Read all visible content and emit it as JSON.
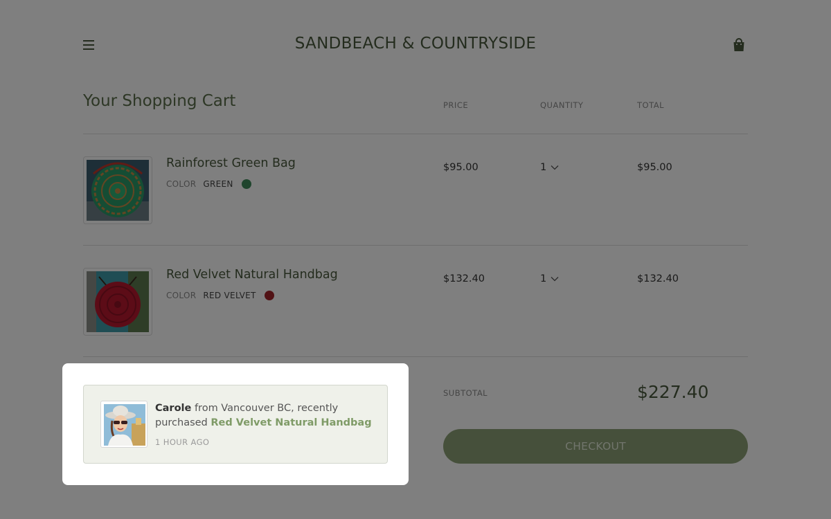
{
  "header": {
    "brand": "SANDBEACH & COUNTRYSIDE",
    "menu_icon": "hamburger-menu-icon",
    "cart_icon": "shopping-bag-icon"
  },
  "cart": {
    "title": "Your Shopping Cart",
    "columns": {
      "price": "PRICE",
      "quantity": "QUANTITY",
      "total": "TOTAL"
    },
    "items": [
      {
        "name": "Rainforest Green Bag",
        "color_label": "COLOR",
        "color_name": "GREEN",
        "swatch": "#3f8a5a",
        "price": "$95.00",
        "quantity": "1",
        "total": "$95.00"
      },
      {
        "name": "Red Velvet Natural Handbag",
        "color_label": "COLOR",
        "color_name": "RED VELVET",
        "swatch": "#a3252a",
        "price": "$132.40",
        "quantity": "1",
        "total": "$132.40"
      }
    ],
    "subtotal_label": "SUBTOTAL",
    "subtotal_value": "$227.40",
    "checkout_label": "CHECKOUT"
  },
  "notification": {
    "customer": "Carole",
    "location_text": "from Vancouver BC, recently purchased",
    "product": "Red Velvet Natural Handbag",
    "time": "1 HOUR AGO"
  },
  "colors": {
    "brand_green": "#48593c",
    "button_green": "#8da177",
    "overlay": "rgba(0,0,0,0.5)"
  }
}
